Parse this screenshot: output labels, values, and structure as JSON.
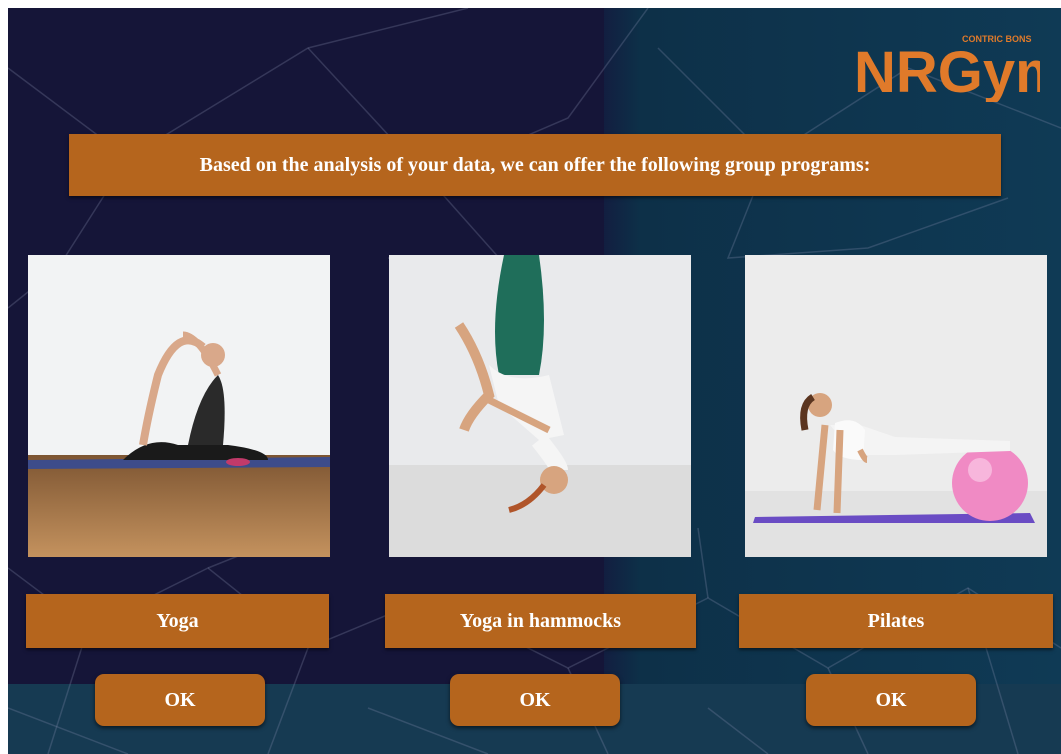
{
  "logo": {
    "text": "NRGym",
    "tagline": "CONTRIC BONS",
    "color": "#e07a2a"
  },
  "banner": {
    "text": "Based on the analysis of your data, we can offer the following group programs:"
  },
  "programs": [
    {
      "label": "Yoga",
      "ok": "OK",
      "image": "woman-yoga-pose-photo"
    },
    {
      "label": "Yoga in hammocks",
      "ok": "OK",
      "image": "aerial-yoga-hammock-photo"
    },
    {
      "label": "Pilates",
      "ok": "OK",
      "image": "pilates-ball-photo"
    }
  ],
  "colors": {
    "accent": "#b5651d",
    "background": "#151538",
    "text": "#ffffff"
  }
}
